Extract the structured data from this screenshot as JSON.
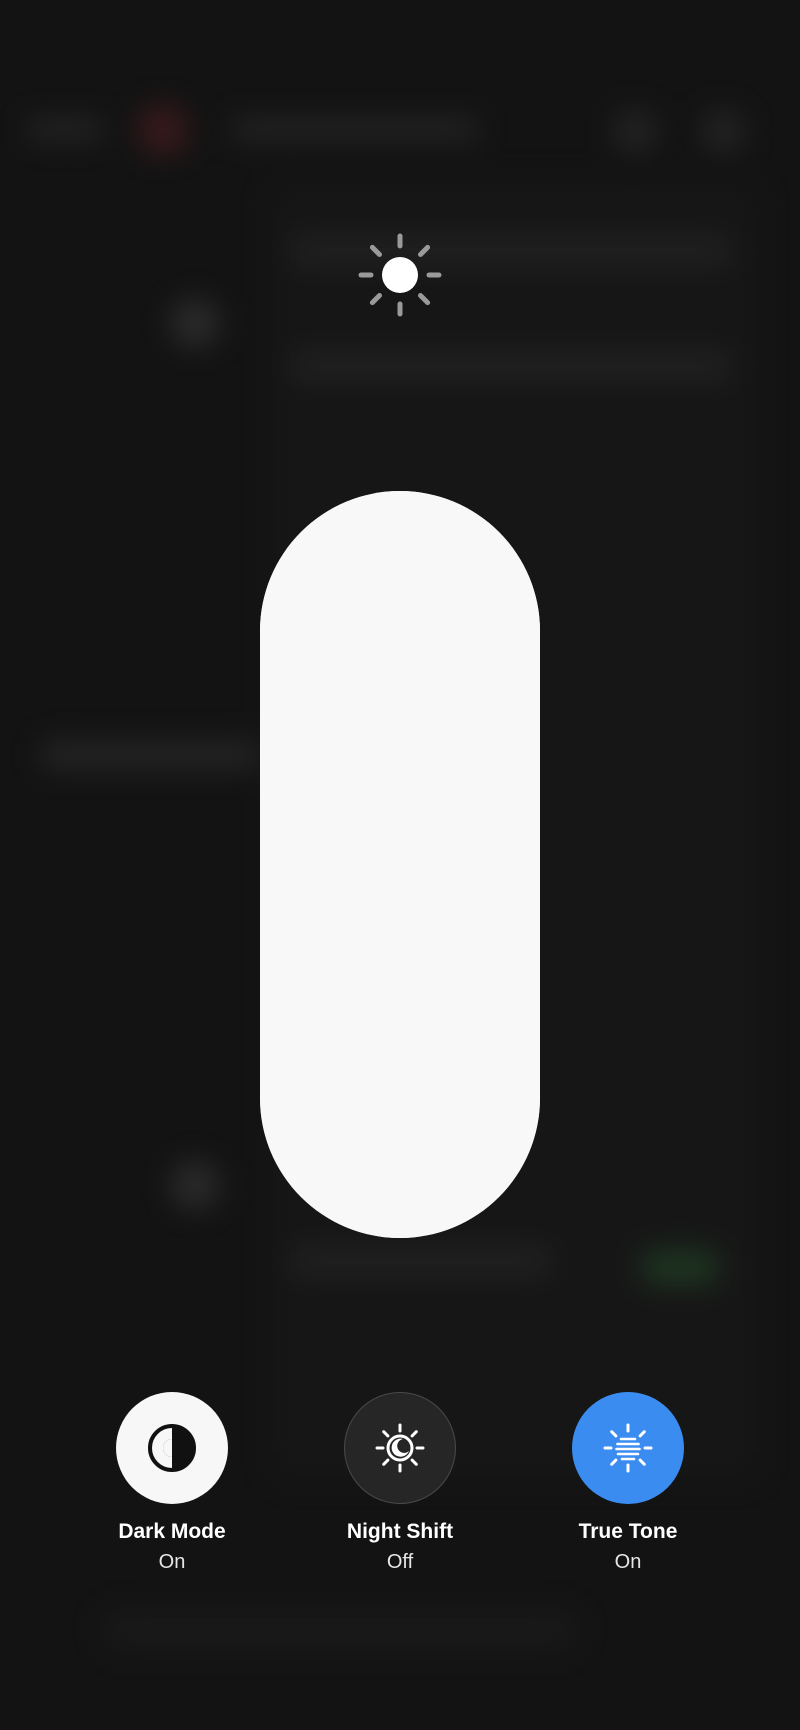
{
  "brightness": {
    "icon": "sun-icon",
    "level_percent": 100
  },
  "controls": [
    {
      "id": "dark-mode",
      "label": "Dark Mode",
      "state": "On",
      "icon": "dark-mode-icon",
      "active_color": "#f7f7f7"
    },
    {
      "id": "night-shift",
      "label": "Night Shift",
      "state": "Off",
      "icon": "night-shift-icon",
      "active_color": "#262626"
    },
    {
      "id": "true-tone",
      "label": "True Tone",
      "state": "On",
      "icon": "true-tone-icon",
      "active_color": "#3b8cf0"
    }
  ],
  "colors": {
    "background": "#131313",
    "slider": "#f6f6f6",
    "accent_blue": "#3b8cf0"
  }
}
